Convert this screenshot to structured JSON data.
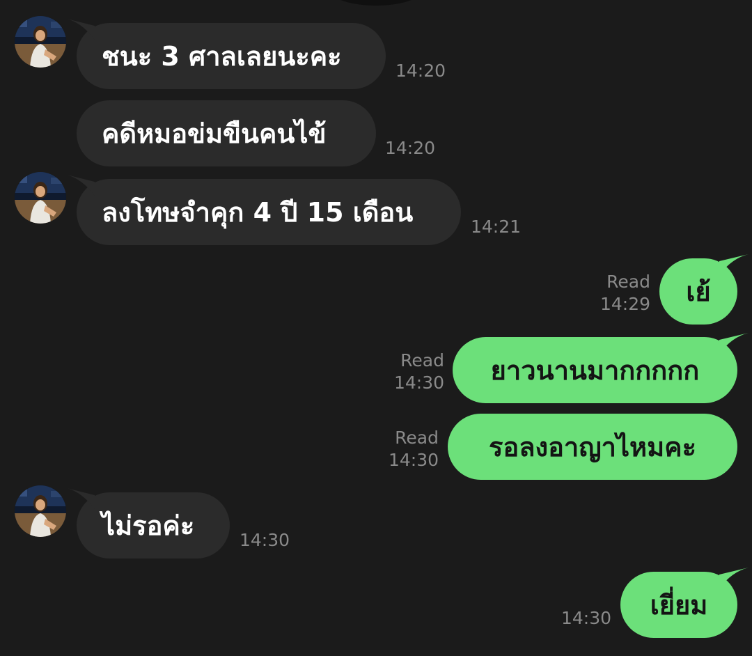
{
  "colors": {
    "background": "#1b1b1b",
    "incoming_bubble": "#2b2b2b",
    "outgoing_bubble": "#6ce07a",
    "meta_text": "#8a8a8a"
  },
  "messages": [
    {
      "direction": "in",
      "text": "ชนะ 3 ศาลเลยนะคะ",
      "time": "14:20",
      "avatar": true
    },
    {
      "direction": "in",
      "text": "คดีหมอข่มขืนคนไข้",
      "time": "14:20",
      "avatar": false
    },
    {
      "direction": "in",
      "text": "ลงโทษจำคุก 4 ปี 15 เดือน",
      "time": "14:21",
      "avatar": true
    },
    {
      "direction": "out",
      "text": "เย้",
      "status": "Read",
      "time": "14:29"
    },
    {
      "direction": "out",
      "text": "ยาวนานมากกกกก",
      "status": "Read",
      "time": "14:30"
    },
    {
      "direction": "out",
      "text": "รอลงอาญาไหมคะ",
      "status": "Read",
      "time": "14:30"
    },
    {
      "direction": "in",
      "text": "ไม่รอค่ะ",
      "time": "14:30",
      "avatar": true
    },
    {
      "direction": "out",
      "text": "เยี่ยม",
      "time": "14:30"
    }
  ]
}
